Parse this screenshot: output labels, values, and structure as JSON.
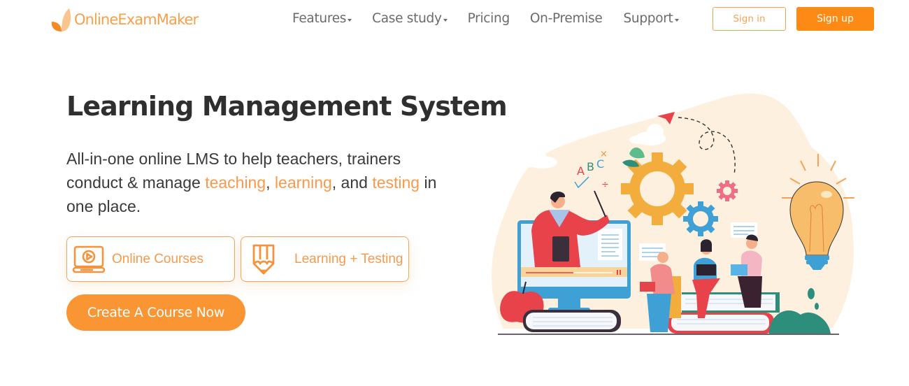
{
  "brand": {
    "name": "OnlineExamMaker",
    "logo_icon": "leaf-logo-icon",
    "accent_color": "#fd8a14",
    "highlight_color": "#f79a4c"
  },
  "nav": {
    "items": [
      {
        "label": "Features",
        "has_dropdown": true
      },
      {
        "label": "Case study",
        "has_dropdown": true
      },
      {
        "label": "Pricing",
        "has_dropdown": false
      },
      {
        "label": "On-Premise",
        "has_dropdown": false
      },
      {
        "label": "Support",
        "has_dropdown": true
      }
    ],
    "signin_label": "Sign in",
    "signup_label": "Sign up"
  },
  "hero": {
    "title": "Learning Management System",
    "description": {
      "part1": "All-in-one online LMS to help teachers, trainers conduct & manage ",
      "hl1": "teaching",
      "sep1": ", ",
      "hl2": "learning",
      "sep2": ", and ",
      "hl3": "testing",
      "part2": " in one place."
    },
    "cards": [
      {
        "label": "Online Courses",
        "icon": "laptop-play-icon"
      },
      {
        "label": "Learning + Testing",
        "icon": "pencil-icon"
      }
    ],
    "cta_label": "Create A Course Now"
  },
  "illustration": {
    "description": "Teacher on monitor with students on books, gears and light bulb",
    "letters": "ABC"
  }
}
